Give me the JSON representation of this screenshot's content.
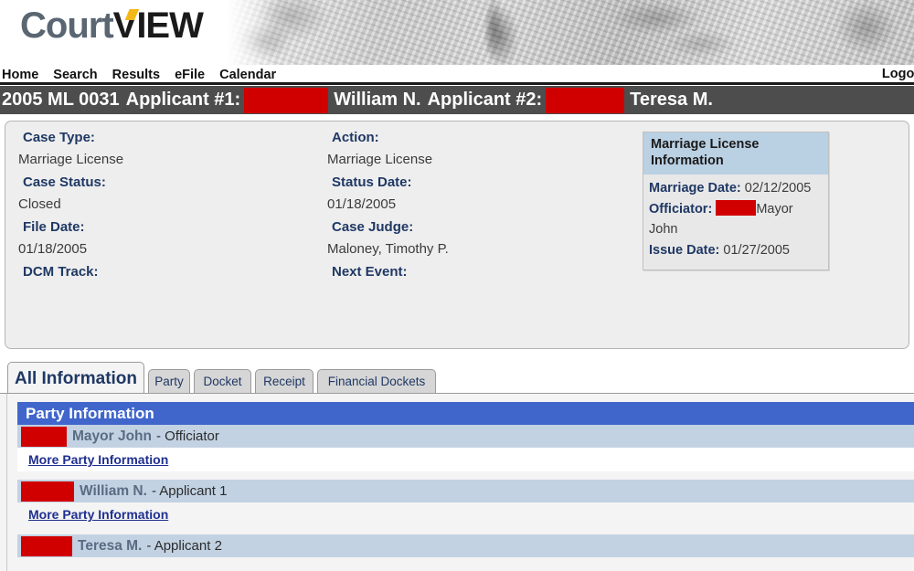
{
  "brand": {
    "logo_part1": "Court",
    "logo_part2": "VIEW",
    "accent_color": "#f3b717",
    "court_color": "#5a6672"
  },
  "nav": {
    "items": [
      {
        "label": "Home",
        "name": "home"
      },
      {
        "label": "Search",
        "name": "search"
      },
      {
        "label": "Results",
        "name": "results"
      },
      {
        "label": "eFile",
        "name": "efile"
      },
      {
        "label": "Calendar",
        "name": "calendar"
      }
    ],
    "right_label": "Logout"
  },
  "case_bar": {
    "case_number": "2005 ML 0031",
    "applicant1_label": "Applicant #1:",
    "applicant1_name": "William N.",
    "applicant2_label": "Applicant #2:",
    "applicant2_name": "Teresa M.",
    "background_color": "#4d4d4d",
    "redaction_color": "#d10000"
  },
  "case_info": {
    "left_column": [
      {
        "label": "Case Type:",
        "value": "Marriage License"
      },
      {
        "label": "Case Status:",
        "value": "Closed"
      },
      {
        "label": "File Date:",
        "value": "01/18/2005"
      },
      {
        "label": "DCM Track:",
        "value": ""
      }
    ],
    "right_column": [
      {
        "label": "Action:",
        "value": "Marriage License"
      },
      {
        "label": "Status Date:",
        "value": "01/18/2005"
      },
      {
        "label": "Case Judge:",
        "value": "Maloney, Timothy P."
      },
      {
        "label": "Next Event:",
        "value": ""
      }
    ]
  },
  "marriage_license_box": {
    "title": "Marriage License Information",
    "header_color": "#bad0e3",
    "rows": [
      {
        "key": "Marriage Date:",
        "value": "02/12/2005",
        "redacted": false
      },
      {
        "key": "Officiator:",
        "value": "Mayor John",
        "redacted": true
      },
      {
        "key": "Issue Date:",
        "value": "01/27/2005",
        "redacted": false
      }
    ]
  },
  "tabs": [
    {
      "label": "All Information",
      "active": true
    },
    {
      "label": "Party",
      "active": false
    },
    {
      "label": "Docket",
      "active": false
    },
    {
      "label": "Receipt",
      "active": false
    },
    {
      "label": "Financial Dockets",
      "active": false
    }
  ],
  "party_section": {
    "header": "Party Information",
    "header_color": "#4066cc",
    "row_color": "#c3d2e3",
    "more_link_label": "More Party Information",
    "parties": [
      {
        "name": "Mayor John",
        "role": "- Officiator",
        "redaction_width": 50,
        "has_more_link": true,
        "more_link_bg": "white"
      },
      {
        "name": "William N.",
        "role": "- Applicant 1",
        "redaction_width": 58,
        "has_more_link": true,
        "more_link_bg": "gray"
      },
      {
        "name": "Teresa M.",
        "role": "- Applicant 2",
        "redaction_width": 56,
        "has_more_link": false,
        "more_link_bg": "gray"
      }
    ]
  }
}
